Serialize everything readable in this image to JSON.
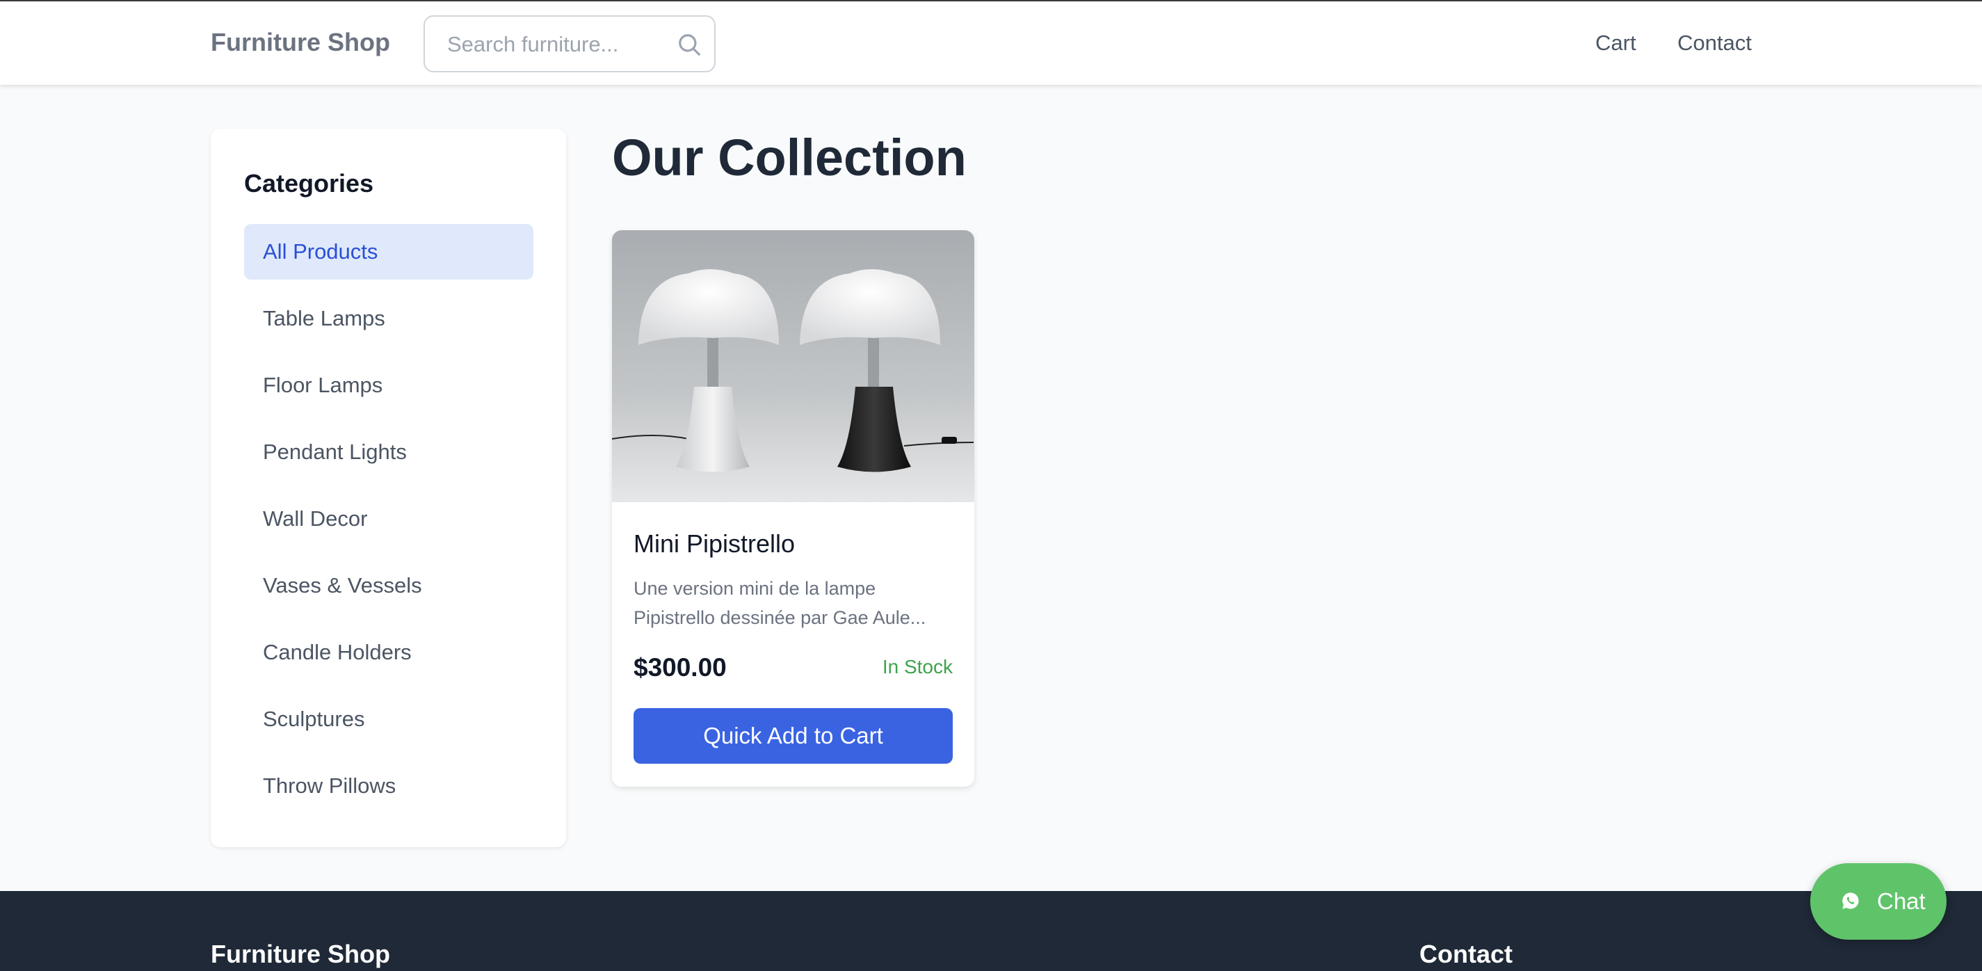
{
  "header": {
    "brand": "Furniture Shop",
    "search_placeholder": "Search furniture...",
    "nav": [
      "Cart",
      "Contact"
    ]
  },
  "sidebar": {
    "title": "Categories",
    "items": [
      "All Products",
      "Table Lamps",
      "Floor Lamps",
      "Pendant Lights",
      "Wall Decor",
      "Vases & Vessels",
      "Candle Holders",
      "Sculptures",
      "Throw Pillows"
    ],
    "active": "All Products"
  },
  "main": {
    "title": "Our Collection",
    "products": [
      {
        "name": "Mini Pipistrello",
        "description": "Une version mini de la lampe Pipistrello dessinée par Gae Aule...",
        "price": "$300.00",
        "stock": "In Stock",
        "button": "Quick Add to Cart"
      }
    ]
  },
  "footer": {
    "brand": "Furniture Shop",
    "contact": "Contact"
  },
  "chat": {
    "label": "Chat"
  },
  "colors": {
    "accent": "#3a63e2",
    "stock": "#3fa34d",
    "chat": "#5fc36a",
    "footer": "#1f2937"
  }
}
